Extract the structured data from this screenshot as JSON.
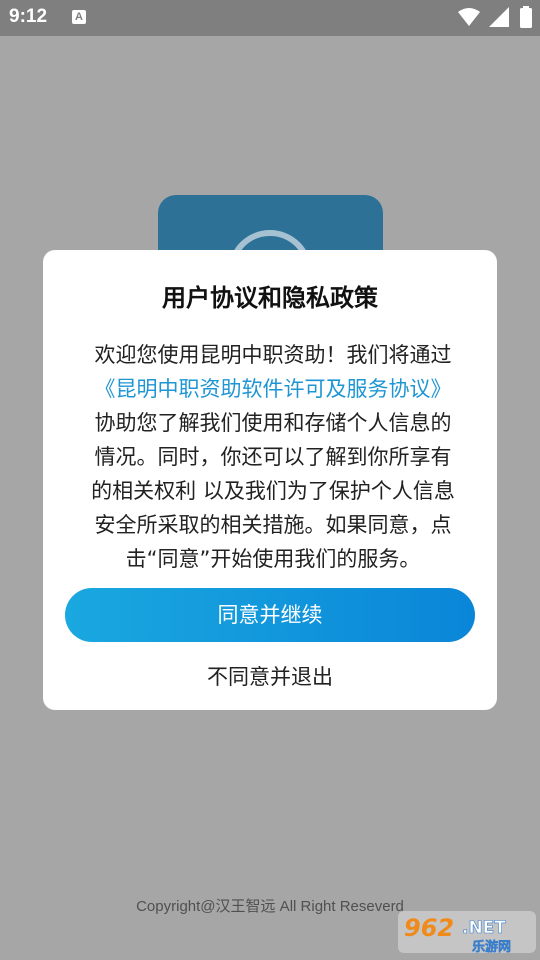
{
  "statusbar": {
    "time": "9:12",
    "notification_letter": "A",
    "icons": [
      "wifi-icon",
      "signal-icon",
      "battery-icon"
    ]
  },
  "dialog": {
    "title": "用户协议和隐私政策",
    "body": {
      "line1": "欢迎您使用昆明中职资助！我们将通过",
      "link": "《昆明中职资助软件许可及服务协议》",
      "line3": "协助您了解我们使用和存储个人信息的",
      "line4": "情况。同时，你还可以了解到你所享有",
      "line5": "的相关权利 以及我们为了保护个人信息",
      "line6": "安全所采取的相关措施。如果同意，点",
      "line7": "击“同意”开始使用我们的服务。"
    },
    "agree_label": "同意并继续",
    "disagree_label": "不同意并退出"
  },
  "footer": {
    "copyright": "Copyright@汉王智远 All Right Reseverd"
  },
  "watermark": {
    "number": "962",
    "suffix": ".NET",
    "name": "乐游网"
  },
  "colors": {
    "accent": "#1f96d4",
    "overlay": "#a6a6a6",
    "button_start": "#1aa8e0",
    "button_end": "#0a86d8"
  }
}
